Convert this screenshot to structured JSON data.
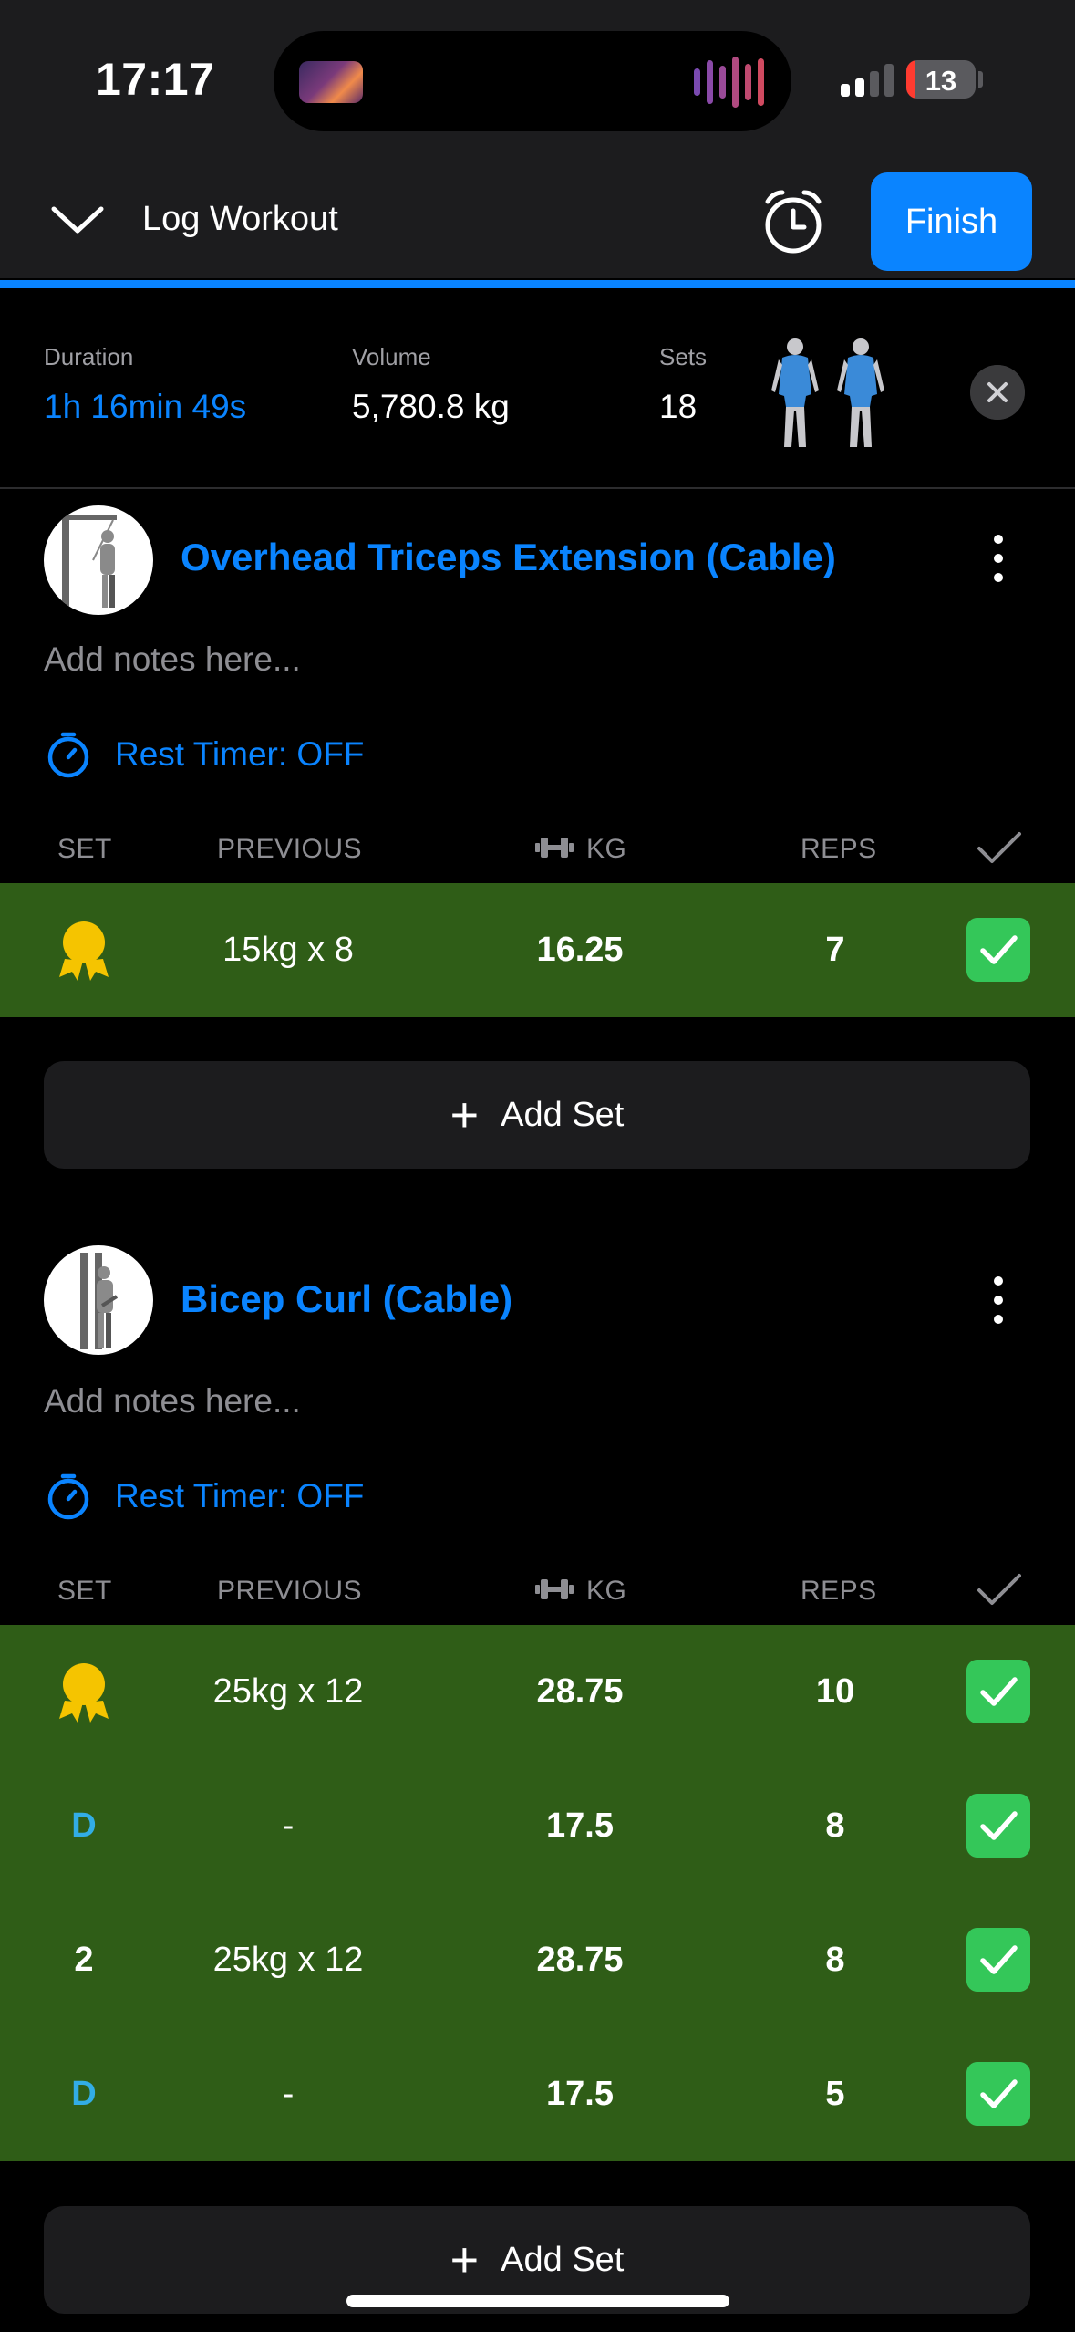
{
  "status_bar": {
    "time": "17:17",
    "battery": "13",
    "battery_fraction": 0.13
  },
  "header": {
    "title": "Log Workout",
    "finish_label": "Finish"
  },
  "summary": {
    "duration_label": "Duration",
    "duration_value": "1h 16min 49s",
    "volume_label": "Volume",
    "volume_value": "5,780.8 kg",
    "sets_label": "Sets",
    "sets_value": "18"
  },
  "columns": {
    "set": "SET",
    "previous": "PREVIOUS",
    "kg": "KG",
    "reps": "REPS"
  },
  "exercises": [
    {
      "title": "Overhead Triceps Extension (Cable)",
      "notes_placeholder": "Add notes here...",
      "rest_timer": "Rest Timer: OFF",
      "sets": [
        {
          "set": "medal",
          "previous": "15kg x 8",
          "kg": "16.25",
          "reps": "7",
          "done": true
        }
      ],
      "add_set_label": "Add Set"
    },
    {
      "title": "Bicep Curl (Cable)",
      "notes_placeholder": "Add notes here...",
      "rest_timer": "Rest Timer: OFF",
      "sets": [
        {
          "set": "medal",
          "previous": "25kg x 12",
          "kg": "28.75",
          "reps": "10",
          "done": true
        },
        {
          "set": "D",
          "previous": "-",
          "kg": "17.5",
          "reps": "8",
          "done": true
        },
        {
          "set": "2",
          "previous": "25kg x 12",
          "kg": "28.75",
          "reps": "8",
          "done": true
        },
        {
          "set": "D",
          "previous": "-",
          "kg": "17.5",
          "reps": "5",
          "done": true
        }
      ],
      "add_set_label": "Add Set"
    }
  ],
  "colors": {
    "accent": "#0a84ff",
    "completed_row": "#2f5d17",
    "check": "#34c759",
    "drop_set": "#32ade6",
    "medal": "#f5c400"
  }
}
